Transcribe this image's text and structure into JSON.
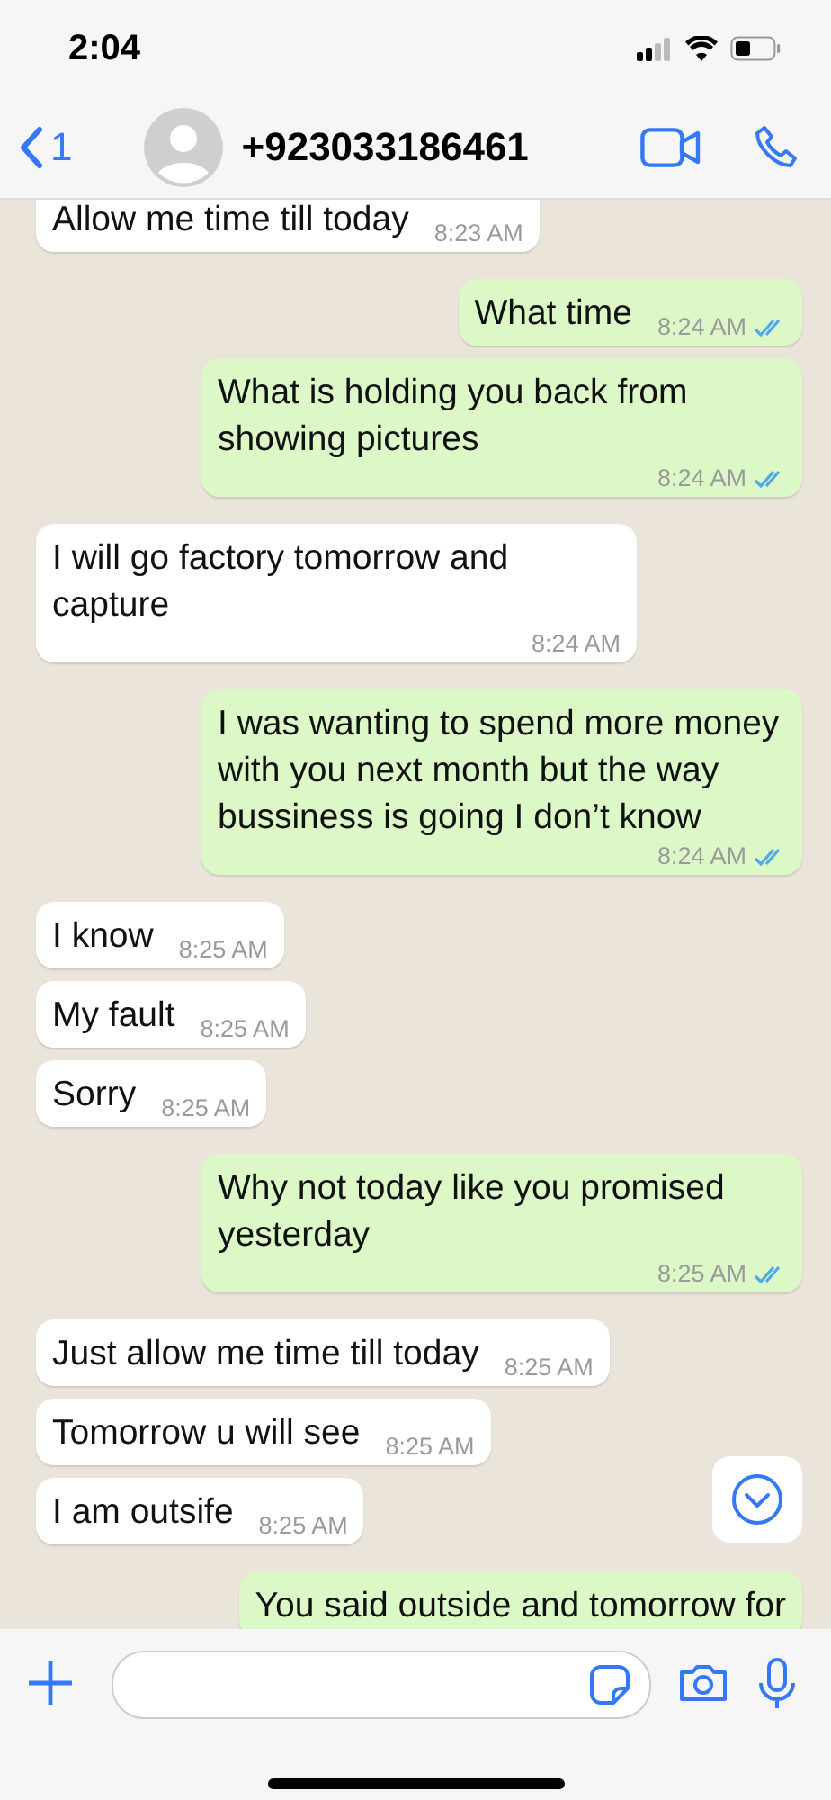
{
  "status_bar": {
    "time": "2:04"
  },
  "header": {
    "back_count": "1",
    "contact": "+923033186461"
  },
  "messages": [
    {
      "kind": "incoming",
      "text": "Allow me time till today",
      "time": "8:23 AM"
    },
    {
      "kind": "outgoing",
      "text": "What time",
      "time": "8:24 AM",
      "read": true
    },
    {
      "kind": "outgoing",
      "text": "What is holding you back from showing pictures",
      "time": "8:24 AM",
      "read": true
    },
    {
      "kind": "incoming",
      "text": "I will go factory tomorrow and capture",
      "time": "8:24 AM"
    },
    {
      "kind": "outgoing",
      "text": "I was wanting to spend more money with you next month but the way bussiness is going I don’t know",
      "time": "8:24 AM",
      "read": true
    },
    {
      "kind": "incoming",
      "text": "I know",
      "time": "8:25 AM"
    },
    {
      "kind": "incoming",
      "text": "My fault",
      "time": "8:25 AM"
    },
    {
      "kind": "incoming",
      "text": "Sorry",
      "time": "8:25 AM"
    },
    {
      "kind": "outgoing",
      "text": "Why not today like you promised yesterday",
      "time": "8:25 AM",
      "read": true
    },
    {
      "kind": "incoming",
      "text": "Just allow me time till today",
      "time": "8:25 AM"
    },
    {
      "kind": "incoming",
      "text": "Tomorrow u will see",
      "time": "8:25 AM"
    },
    {
      "kind": "incoming",
      "text": "I am outsife",
      "time": "8:25 AM"
    },
    {
      "kind": "outgoing",
      "text": "You said outside and tomorrow for"
    }
  ]
}
